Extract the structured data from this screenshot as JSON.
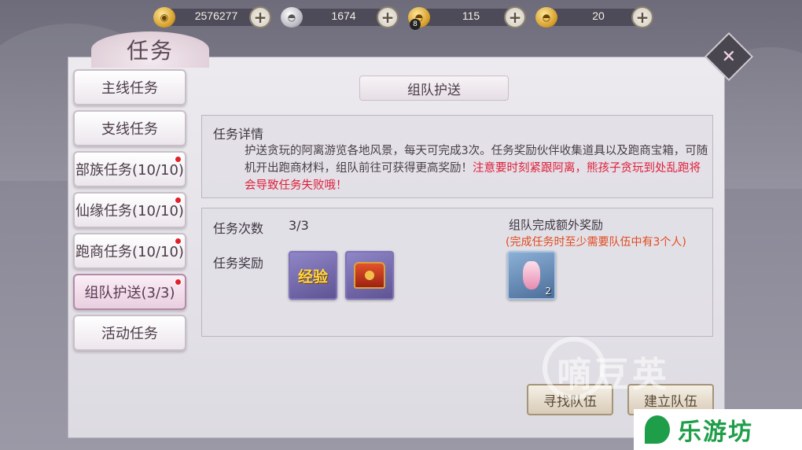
{
  "currencies": [
    {
      "icon": "copper-coin-icon",
      "value": "2576277"
    },
    {
      "icon": "silver-ingot-icon",
      "value": "1674"
    },
    {
      "icon": "gold-ingot-bound-icon",
      "badge": "8",
      "value": "115"
    },
    {
      "icon": "gold-ingot-icon",
      "value": "20"
    }
  ],
  "window_title": "任务",
  "sidebar": [
    {
      "label": "主线任务",
      "dot": false
    },
    {
      "label": "支线任务",
      "dot": false
    },
    {
      "label": "部族任务(10/10)",
      "dot": true
    },
    {
      "label": "仙缘任务(10/10)",
      "dot": true
    },
    {
      "label": "跑商任务(10/10)",
      "dot": true
    },
    {
      "label": "组队护送(3/3)",
      "dot": true,
      "active": true
    },
    {
      "label": "活动任务",
      "dot": false
    }
  ],
  "section_title": "组队护送",
  "detail": {
    "heading": "任务详情",
    "text": "护送贪玩的阿离游览各地风景，每天可完成3次。任务奖励伙伴收集道具以及跑商宝箱，可随机开出跑商材料，组队前往可获得更高奖励！",
    "warning": "注意要时刻紧跟阿离，熊孩子贪玩到处乱跑将会导致任务失败哦！"
  },
  "reward": {
    "count_label": "任务次数",
    "count_value": "3/3",
    "reward_label": "任务奖励",
    "items": [
      {
        "icon": "exp-icon",
        "text": "经验"
      },
      {
        "icon": "treasure-chest-icon"
      }
    ],
    "extra_label": "组队完成额外奖励",
    "extra_note": "(完成任务时至少需要队伍中有3个人)",
    "extra_item": {
      "icon": "vase-icon",
      "count": "2"
    }
  },
  "buttons": {
    "find_team": "寻找队伍",
    "create_team": "建立队伍"
  },
  "watermark": "嘀豆英",
  "logo_text": "乐游坊",
  "colors": {
    "warning": "#e0203a",
    "note": "#e24a1e",
    "notify_dot": "#e0202a",
    "logo_green": "#1f9e4a"
  }
}
